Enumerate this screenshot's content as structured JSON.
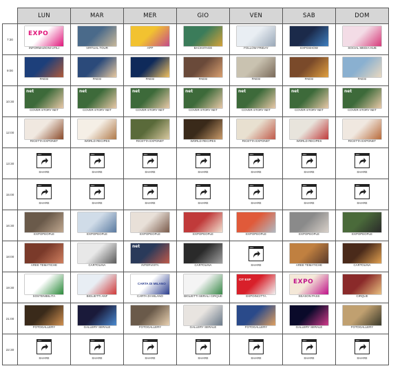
{
  "days": [
    "LUN",
    "MAR",
    "MER",
    "GIO",
    "VEN",
    "SAB",
    "DOM"
  ],
  "slots": [
    {
      "time": "7:30",
      "cells": [
        {
          "label": "INFORMAZIONI UTILI",
          "kind": "expo",
          "colors": [
            "#ffffff",
            "#e0157a"
          ]
        },
        {
          "label": "VIRTUAL TOUR",
          "kind": "photo",
          "colors": [
            "#4a6a8a",
            "#c8b89a"
          ]
        },
        {
          "label": "APP",
          "kind": "photo",
          "colors": [
            "#f2c230",
            "#c44b8a"
          ]
        },
        {
          "label": "BACKSTAGE",
          "kind": "photo",
          "colors": [
            "#3b7c5a",
            "#d4a23a"
          ]
        },
        {
          "label": "FOLLOW FRIDAY",
          "kind": "photo",
          "colors": [
            "#e9eef3",
            "#9aa8b8"
          ]
        },
        {
          "label": "EXPOSHOW",
          "kind": "photo",
          "colors": [
            "#1b2a4a",
            "#3f7fbf"
          ]
        },
        {
          "label": "SOCIAL MEDIA HUB",
          "kind": "photo",
          "colors": [
            "#f3dce6",
            "#d63a7a"
          ]
        }
      ]
    },
    {
      "time": "9:00",
      "cells": [
        {
          "label": "PAESI",
          "kind": "photo",
          "colors": [
            "#1d3f7a",
            "#b05a3a"
          ]
        },
        {
          "label": "PAESI",
          "kind": "photo",
          "colors": [
            "#2b4a7a",
            "#e8c9a0"
          ]
        },
        {
          "label": "PAESI",
          "kind": "photo",
          "colors": [
            "#0f2a5a",
            "#f0c060"
          ]
        },
        {
          "label": "PAESI",
          "kind": "photo",
          "colors": [
            "#6a4a3a",
            "#d9a070"
          ]
        },
        {
          "label": "PAESI",
          "kind": "photo",
          "colors": [
            "#c9c2b0",
            "#7a6a5a"
          ]
        },
        {
          "label": "PAESI",
          "kind": "photo",
          "colors": [
            "#7a4a2a",
            "#e0a040"
          ]
        },
        {
          "label": "PAESI",
          "kind": "photo",
          "colors": [
            "#8ab0d0",
            "#e8d8c0"
          ]
        }
      ]
    },
    {
      "time": "10:30",
      "cells": [
        {
          "label": "COVER STORY NET",
          "kind": "net",
          "colors": [
            "#3d6a3a",
            "#e8c8a8"
          ]
        },
        {
          "label": "COVER STORY NET",
          "kind": "net",
          "colors": [
            "#3d6a3a",
            "#e8c8a8"
          ]
        },
        {
          "label": "COVER STORY NET",
          "kind": "net",
          "colors": [
            "#3d6a3a",
            "#e8c8a8"
          ]
        },
        {
          "label": "COVER STORY NET",
          "kind": "net",
          "colors": [
            "#3d6a3a",
            "#e8c8a8"
          ]
        },
        {
          "label": "COVER STORY NET",
          "kind": "net",
          "colors": [
            "#3d6a3a",
            "#e8c8a8"
          ]
        },
        {
          "label": "COVER STORY NET",
          "kind": "net",
          "colors": [
            "#3d6a3a",
            "#e8c8a8"
          ]
        },
        {
          "label": "COVER STORY NET",
          "kind": "net",
          "colors": [
            "#3d6a3a",
            "#e8c8a8"
          ]
        }
      ]
    },
    {
      "time": "12:00",
      "cells": [
        {
          "label": "RICETTA EXPONET",
          "kind": "photo",
          "colors": [
            "#f0e8e0",
            "#8a4a2a"
          ]
        },
        {
          "label": "WORLD RECIPES",
          "kind": "photo",
          "colors": [
            "#f5efe6",
            "#b07a4a"
          ]
        },
        {
          "label": "RICETTA EXPONET",
          "kind": "photo",
          "colors": [
            "#5a6a3a",
            "#d8c8a0"
          ]
        },
        {
          "label": "WORLD RECIPES",
          "kind": "photo",
          "colors": [
            "#3a2a1a",
            "#c89a6a"
          ]
        },
        {
          "label": "RICETTA EXPONET",
          "kind": "photo",
          "colors": [
            "#e8e0d0",
            "#c05a4a"
          ]
        },
        {
          "label": "WORLD RECIPES",
          "kind": "photo",
          "colors": [
            "#e8e4dc",
            "#c03a3a"
          ]
        },
        {
          "label": "RICETTA EXPONET",
          "kind": "photo",
          "colors": [
            "#f0e8e0",
            "#b86a3a"
          ]
        }
      ]
    },
    {
      "time": "13:30",
      "cells": [
        {
          "label": "SHARE",
          "kind": "share"
        },
        {
          "label": "SHARE",
          "kind": "share"
        },
        {
          "label": "SHARE",
          "kind": "share"
        },
        {
          "label": "SHARE",
          "kind": "share"
        },
        {
          "label": "SHARE",
          "kind": "share"
        },
        {
          "label": "SHARE",
          "kind": "share"
        },
        {
          "label": "SHARE",
          "kind": "share"
        }
      ]
    },
    {
      "time": "15:00",
      "cells": [
        {
          "label": "SHARE",
          "kind": "share"
        },
        {
          "label": "SHARE",
          "kind": "share"
        },
        {
          "label": "SHARE",
          "kind": "share"
        },
        {
          "label": "SHARE",
          "kind": "share"
        },
        {
          "label": "SHARE",
          "kind": "share"
        },
        {
          "label": "SHARE",
          "kind": "share"
        },
        {
          "label": "SHARE",
          "kind": "share"
        }
      ]
    },
    {
      "time": "16:30",
      "cells": [
        {
          "label": "EXPOPEOPLE",
          "kind": "photo",
          "colors": [
            "#6a5a4a",
            "#c0a890"
          ]
        },
        {
          "label": "EXPOPEOPLE",
          "kind": "photo",
          "colors": [
            "#d0dce8",
            "#5a7aa0"
          ]
        },
        {
          "label": "EXPOPEOPLE",
          "kind": "photo",
          "colors": [
            "#e8e0d8",
            "#7a5a4a"
          ]
        },
        {
          "label": "EXPOPEOPLE",
          "kind": "photo",
          "colors": [
            "#c03a3a",
            "#f0e0d0"
          ]
        },
        {
          "label": "EXPOPEOPLE",
          "kind": "photo",
          "colors": [
            "#e05a3a",
            "#b0b8c0"
          ]
        },
        {
          "label": "EXPOPEOPLE",
          "kind": "photo",
          "colors": [
            "#8a8a8a",
            "#d8d0c8"
          ]
        },
        {
          "label": "EXPOPEOPLE",
          "kind": "photo",
          "colors": [
            "#4a6a3a",
            "#2a2a2a"
          ]
        }
      ]
    },
    {
      "time": "18:00",
      "cells": [
        {
          "label": "AREE TEMATICHE",
          "kind": "photo",
          "colors": [
            "#7a3a2a",
            "#d08060"
          ]
        },
        {
          "label": "CARTOLINA",
          "kind": "photo",
          "colors": [
            "#e8e8e8",
            "#5a5a5a"
          ]
        },
        {
          "label": "INTERVISTA",
          "kind": "net",
          "colors": [
            "#2a3a5a",
            "#c05a4a"
          ]
        },
        {
          "label": "CARTOLINA",
          "kind": "photo",
          "colors": [
            "#2a2a2a",
            "#a0a0a0"
          ]
        },
        {
          "label": "SHARE",
          "kind": "share"
        },
        {
          "label": "AREE TEMATICHE",
          "kind": "photo",
          "colors": [
            "#c08040",
            "#5a3a2a"
          ]
        },
        {
          "label": "CARTOLINA",
          "kind": "photo",
          "colors": [
            "#4a2a1a",
            "#e0a050"
          ]
        }
      ]
    },
    {
      "time": "19:30",
      "cells": [
        {
          "label": "SOSTENIBILITÀ",
          "kind": "photo",
          "colors": [
            "#ffffff",
            "#2a8a3a"
          ]
        },
        {
          "label": "BIGLIETTI ANF",
          "kind": "photo",
          "colors": [
            "#e8eef4",
            "#d03a3a"
          ]
        },
        {
          "label": "CARTA DI MILANO",
          "kind": "carta",
          "colors": [
            "#ffffff",
            "#2b3e8f"
          ]
        },
        {
          "label": "BIGLIETTI SERALI CIRQUE",
          "kind": "photo",
          "colors": [
            "#f4f4f4",
            "#3a8a4a"
          ]
        },
        {
          "label": "EXPOINCITTÀ",
          "kind": "city",
          "colors": [
            "#d8202a",
            "#f0f0f0"
          ]
        },
        {
          "label": "SEASON PASS",
          "kind": "expo",
          "colors": [
            "#f4e8d8",
            "#c0148a"
          ]
        },
        {
          "label": "CIRQUE",
          "kind": "photo",
          "colors": [
            "#8a2a2a",
            "#e8c080"
          ]
        }
      ]
    },
    {
      "time": "21:00",
      "cells": [
        {
          "label": "FOTOGALLERY",
          "kind": "photo",
          "colors": [
            "#3a2a1a",
            "#d09050"
          ]
        },
        {
          "label": "GALLERY SERALE",
          "kind": "photo",
          "colors": [
            "#1a1a3a",
            "#4a8ad0"
          ]
        },
        {
          "label": "FOTOGALLERY",
          "kind": "photo",
          "colors": [
            "#6a5a4a",
            "#e8d0b0"
          ]
        },
        {
          "label": "GALLERY SERALE",
          "kind": "photo",
          "colors": [
            "#e8e4e0",
            "#6a7a8a"
          ]
        },
        {
          "label": "FOTOGALLERY",
          "kind": "photo",
          "colors": [
            "#2a4a8a",
            "#e0a060"
          ]
        },
        {
          "label": "GALLERY SERALE",
          "kind": "photo",
          "colors": [
            "#0a0a2a",
            "#d03a8a"
          ]
        },
        {
          "label": "FOTOGALLERY",
          "kind": "photo",
          "colors": [
            "#c0a070",
            "#3a3a2a"
          ]
        }
      ]
    },
    {
      "time": "22:30",
      "cells": [
        {
          "label": "SHARE",
          "kind": "share"
        },
        {
          "label": "SHARE",
          "kind": "share"
        },
        {
          "label": "SHARE",
          "kind": "share"
        },
        {
          "label": "SHARE",
          "kind": "share"
        },
        {
          "label": "SHARE",
          "kind": "share"
        },
        {
          "label": "SHARE",
          "kind": "share"
        },
        {
          "label": "SHARE",
          "kind": "share"
        }
      ]
    }
  ],
  "marks": {
    "net": "net",
    "expo": "EXPO",
    "carta": "CARTA DI MILANO",
    "city": "CIT EXP"
  }
}
